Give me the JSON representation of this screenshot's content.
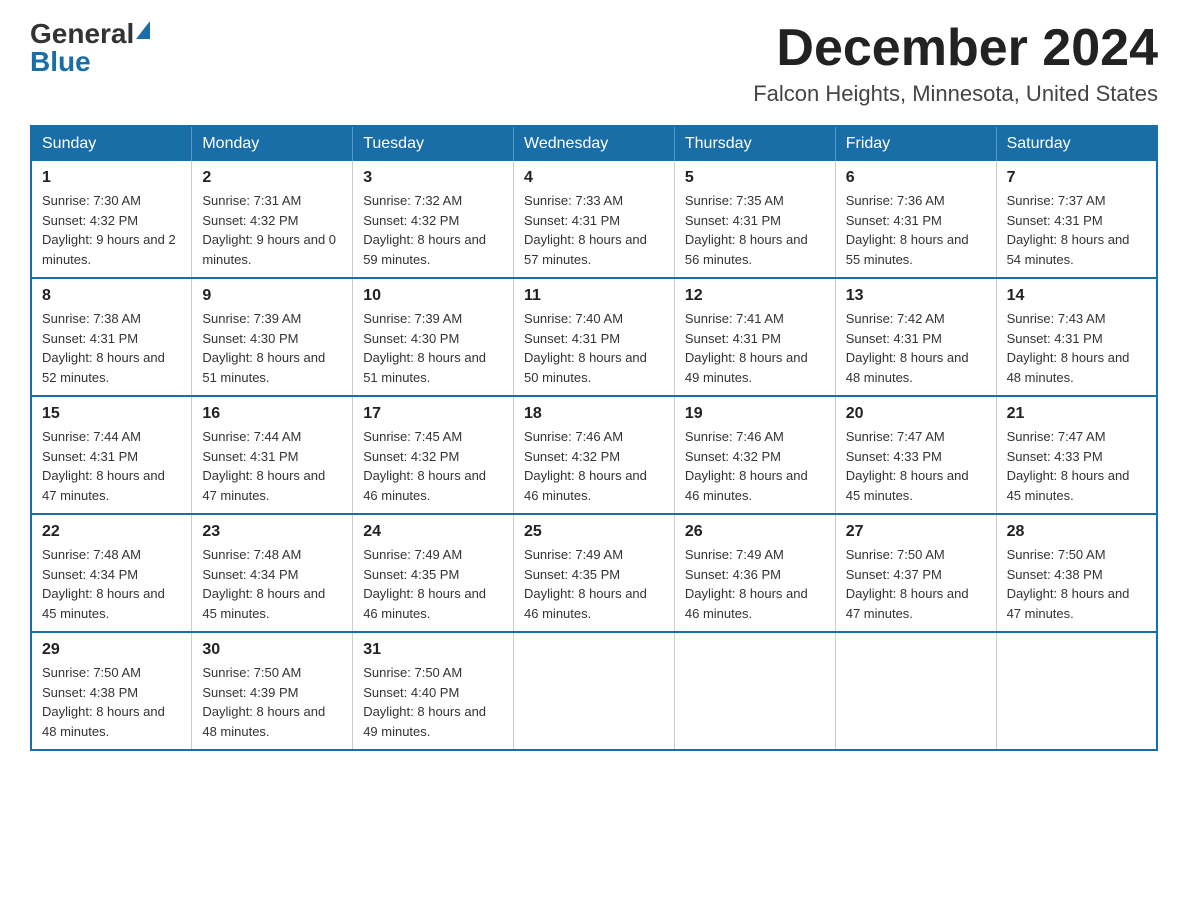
{
  "header": {
    "logo_general": "General",
    "logo_blue": "Blue",
    "month_title": "December 2024",
    "location": "Falcon Heights, Minnesota, United States"
  },
  "weekdays": [
    "Sunday",
    "Monday",
    "Tuesday",
    "Wednesday",
    "Thursday",
    "Friday",
    "Saturday"
  ],
  "weeks": [
    [
      {
        "day": "1",
        "sunrise": "7:30 AM",
        "sunset": "4:32 PM",
        "daylight": "9 hours and 2 minutes."
      },
      {
        "day": "2",
        "sunrise": "7:31 AM",
        "sunset": "4:32 PM",
        "daylight": "9 hours and 0 minutes."
      },
      {
        "day": "3",
        "sunrise": "7:32 AM",
        "sunset": "4:32 PM",
        "daylight": "8 hours and 59 minutes."
      },
      {
        "day": "4",
        "sunrise": "7:33 AM",
        "sunset": "4:31 PM",
        "daylight": "8 hours and 57 minutes."
      },
      {
        "day": "5",
        "sunrise": "7:35 AM",
        "sunset": "4:31 PM",
        "daylight": "8 hours and 56 minutes."
      },
      {
        "day": "6",
        "sunrise": "7:36 AM",
        "sunset": "4:31 PM",
        "daylight": "8 hours and 55 minutes."
      },
      {
        "day": "7",
        "sunrise": "7:37 AM",
        "sunset": "4:31 PM",
        "daylight": "8 hours and 54 minutes."
      }
    ],
    [
      {
        "day": "8",
        "sunrise": "7:38 AM",
        "sunset": "4:31 PM",
        "daylight": "8 hours and 52 minutes."
      },
      {
        "day": "9",
        "sunrise": "7:39 AM",
        "sunset": "4:30 PM",
        "daylight": "8 hours and 51 minutes."
      },
      {
        "day": "10",
        "sunrise": "7:39 AM",
        "sunset": "4:30 PM",
        "daylight": "8 hours and 51 minutes."
      },
      {
        "day": "11",
        "sunrise": "7:40 AM",
        "sunset": "4:31 PM",
        "daylight": "8 hours and 50 minutes."
      },
      {
        "day": "12",
        "sunrise": "7:41 AM",
        "sunset": "4:31 PM",
        "daylight": "8 hours and 49 minutes."
      },
      {
        "day": "13",
        "sunrise": "7:42 AM",
        "sunset": "4:31 PM",
        "daylight": "8 hours and 48 minutes."
      },
      {
        "day": "14",
        "sunrise": "7:43 AM",
        "sunset": "4:31 PM",
        "daylight": "8 hours and 48 minutes."
      }
    ],
    [
      {
        "day": "15",
        "sunrise": "7:44 AM",
        "sunset": "4:31 PM",
        "daylight": "8 hours and 47 minutes."
      },
      {
        "day": "16",
        "sunrise": "7:44 AM",
        "sunset": "4:31 PM",
        "daylight": "8 hours and 47 minutes."
      },
      {
        "day": "17",
        "sunrise": "7:45 AM",
        "sunset": "4:32 PM",
        "daylight": "8 hours and 46 minutes."
      },
      {
        "day": "18",
        "sunrise": "7:46 AM",
        "sunset": "4:32 PM",
        "daylight": "8 hours and 46 minutes."
      },
      {
        "day": "19",
        "sunrise": "7:46 AM",
        "sunset": "4:32 PM",
        "daylight": "8 hours and 46 minutes."
      },
      {
        "day": "20",
        "sunrise": "7:47 AM",
        "sunset": "4:33 PM",
        "daylight": "8 hours and 45 minutes."
      },
      {
        "day": "21",
        "sunrise": "7:47 AM",
        "sunset": "4:33 PM",
        "daylight": "8 hours and 45 minutes."
      }
    ],
    [
      {
        "day": "22",
        "sunrise": "7:48 AM",
        "sunset": "4:34 PM",
        "daylight": "8 hours and 45 minutes."
      },
      {
        "day": "23",
        "sunrise": "7:48 AM",
        "sunset": "4:34 PM",
        "daylight": "8 hours and 45 minutes."
      },
      {
        "day": "24",
        "sunrise": "7:49 AM",
        "sunset": "4:35 PM",
        "daylight": "8 hours and 46 minutes."
      },
      {
        "day": "25",
        "sunrise": "7:49 AM",
        "sunset": "4:35 PM",
        "daylight": "8 hours and 46 minutes."
      },
      {
        "day": "26",
        "sunrise": "7:49 AM",
        "sunset": "4:36 PM",
        "daylight": "8 hours and 46 minutes."
      },
      {
        "day": "27",
        "sunrise": "7:50 AM",
        "sunset": "4:37 PM",
        "daylight": "8 hours and 47 minutes."
      },
      {
        "day": "28",
        "sunrise": "7:50 AM",
        "sunset": "4:38 PM",
        "daylight": "8 hours and 47 minutes."
      }
    ],
    [
      {
        "day": "29",
        "sunrise": "7:50 AM",
        "sunset": "4:38 PM",
        "daylight": "8 hours and 48 minutes."
      },
      {
        "day": "30",
        "sunrise": "7:50 AM",
        "sunset": "4:39 PM",
        "daylight": "8 hours and 48 minutes."
      },
      {
        "day": "31",
        "sunrise": "7:50 AM",
        "sunset": "4:40 PM",
        "daylight": "8 hours and 49 minutes."
      },
      null,
      null,
      null,
      null
    ]
  ]
}
